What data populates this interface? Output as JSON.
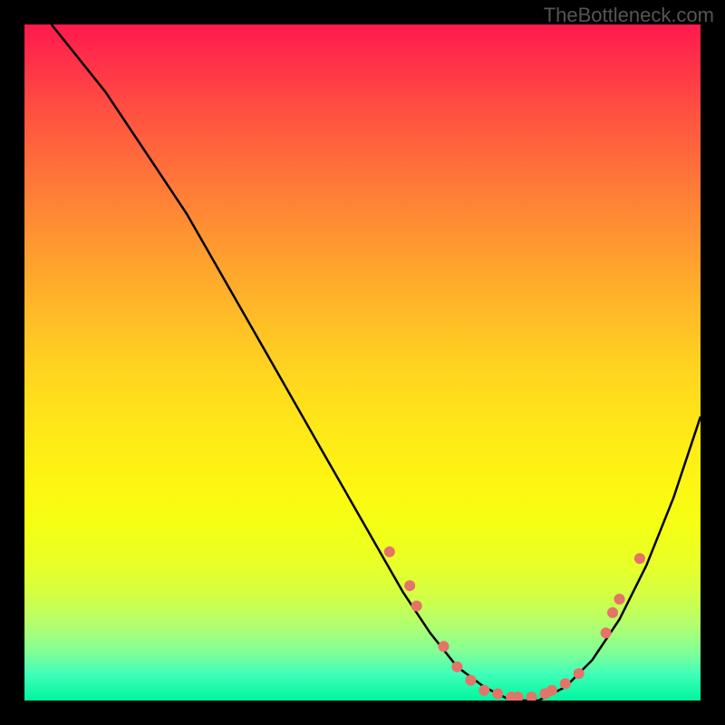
{
  "watermark": "TheBottleneck.com",
  "chart_data": {
    "type": "line",
    "title": "",
    "xlabel": "",
    "ylabel": "",
    "xlim": [
      0,
      100
    ],
    "ylim": [
      0,
      100
    ],
    "grid": false,
    "legend": false,
    "series": [
      {
        "name": "curve",
        "color": "#000000",
        "x": [
          4,
          8,
          12,
          16,
          20,
          24,
          28,
          32,
          36,
          40,
          44,
          48,
          52,
          56,
          60,
          64,
          68,
          72,
          76,
          80,
          84,
          88,
          92,
          96,
          100
        ],
        "y": [
          100,
          95,
          90,
          84,
          78,
          72,
          65,
          58,
          51,
          44,
          37,
          30,
          23,
          16,
          10,
          5,
          2,
          0,
          0,
          2,
          6,
          12,
          20,
          30,
          42
        ]
      }
    ],
    "markers": {
      "color": "#e57368",
      "points": [
        {
          "x": 54,
          "y": 22
        },
        {
          "x": 57,
          "y": 17
        },
        {
          "x": 58,
          "y": 14
        },
        {
          "x": 62,
          "y": 8
        },
        {
          "x": 64,
          "y": 5
        },
        {
          "x": 66,
          "y": 3
        },
        {
          "x": 68,
          "y": 1.5
        },
        {
          "x": 70,
          "y": 1
        },
        {
          "x": 72,
          "y": 0.5
        },
        {
          "x": 73,
          "y": 0.5
        },
        {
          "x": 75,
          "y": 0.5
        },
        {
          "x": 77,
          "y": 1
        },
        {
          "x": 78,
          "y": 1.5
        },
        {
          "x": 80,
          "y": 2.5
        },
        {
          "x": 82,
          "y": 4
        },
        {
          "x": 86,
          "y": 10
        },
        {
          "x": 87,
          "y": 13
        },
        {
          "x": 88,
          "y": 15
        },
        {
          "x": 91,
          "y": 21
        }
      ]
    },
    "background_gradient": {
      "type": "vertical",
      "stops": [
        {
          "pos": 0.0,
          "color": "#ff1a4d"
        },
        {
          "pos": 0.5,
          "color": "#ffd420"
        },
        {
          "pos": 0.75,
          "color": "#f5ff14"
        },
        {
          "pos": 1.0,
          "color": "#00f5a0"
        }
      ]
    }
  }
}
